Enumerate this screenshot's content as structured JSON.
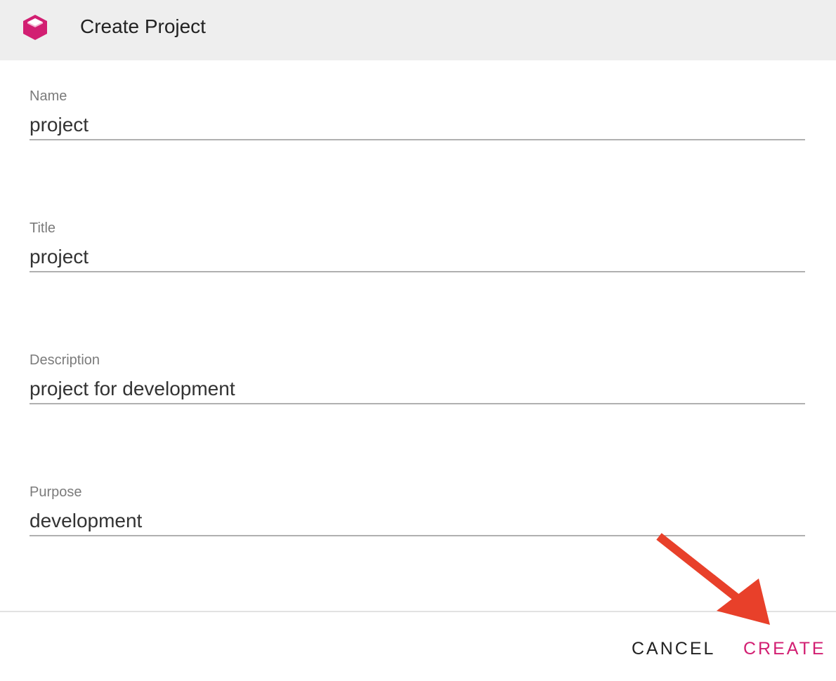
{
  "dialog": {
    "title": "Create Project",
    "logo_icon": "magenta-cube-icon"
  },
  "fields": {
    "name": {
      "label": "Name",
      "value": "project"
    },
    "title": {
      "label": "Title",
      "value": "project"
    },
    "description": {
      "label": "Description",
      "value": "project for development"
    },
    "purpose": {
      "label": "Purpose",
      "value": "development"
    }
  },
  "actions": {
    "cancel_label": "CANCEL",
    "create_label": "CREATE"
  },
  "annotation": {
    "icon": "red-arrow-icon",
    "color": "#e8402a"
  },
  "colors": {
    "accent": "#d21f72",
    "header_bg": "#eeeeee"
  }
}
